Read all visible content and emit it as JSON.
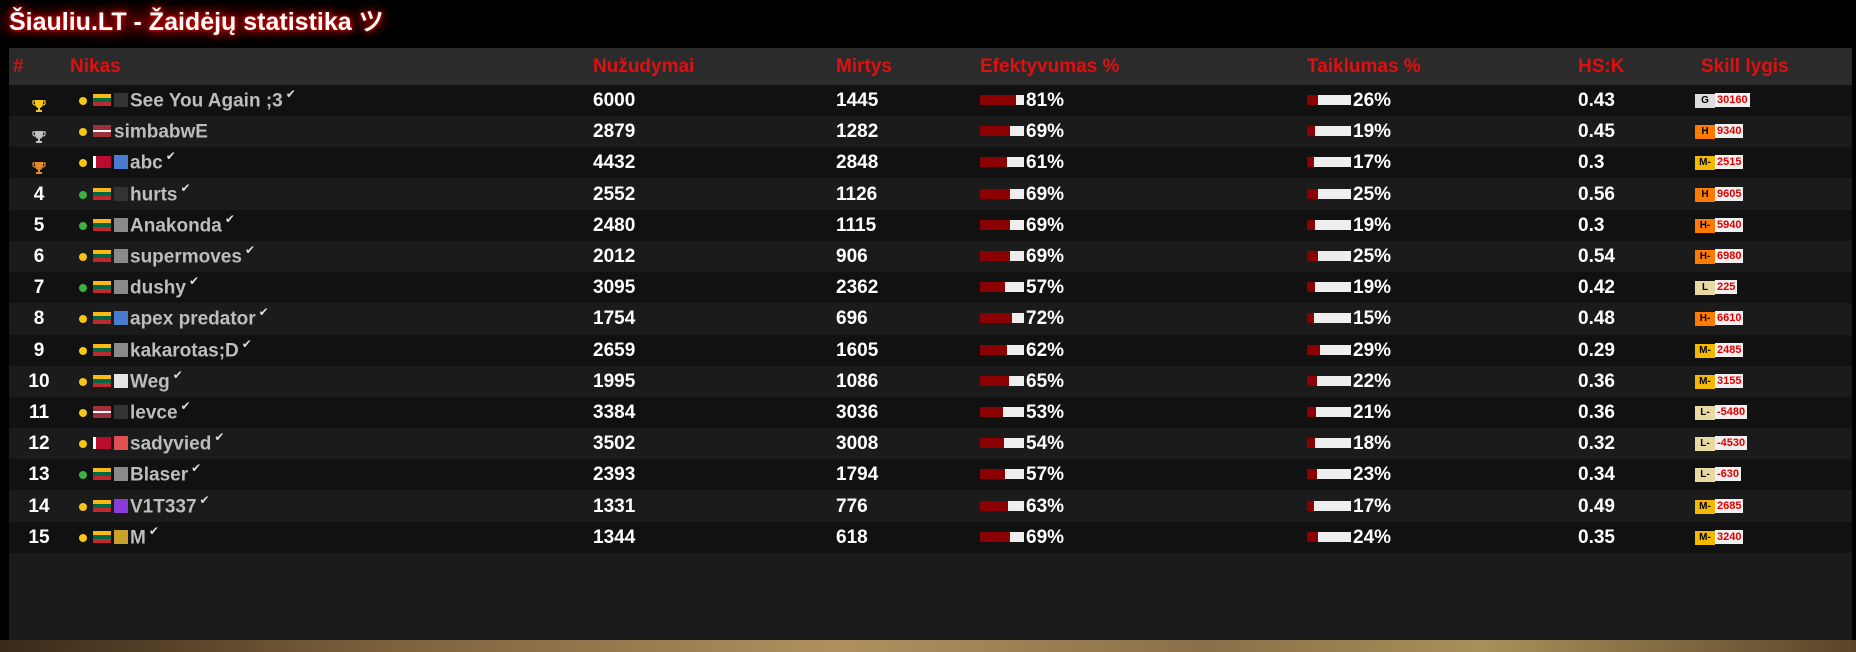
{
  "page": {
    "title": "Šiauliu.LT - Žaidėjų statistika ツ"
  },
  "colors": {
    "accent_red": "#e01010",
    "bar_fill": "#8b0000",
    "gold": "#f5c518",
    "green": "#3cb043"
  },
  "table": {
    "headers": [
      "#",
      "Nikas",
      "Nužudymai",
      "Mirtys",
      "Efektyvumas %",
      "Taiklumas %",
      "HS:K",
      "Skill lygis"
    ],
    "rows": [
      {
        "rank": "",
        "rank_icon": "trophy-gold-icon",
        "status": "gold",
        "flag": "lt",
        "avatar": "dark",
        "name": "See You Again ;3",
        "verified": true,
        "kills": "6000",
        "deaths": "1445",
        "eff": "81%",
        "eff_frac": 0.81,
        "acc": "26%",
        "acc_frac": 0.26,
        "hsk": "0.43",
        "skill_badge": "G",
        "skill_color": "#dddddd",
        "skill_points": "30160"
      },
      {
        "rank": "",
        "rank_icon": "trophy-silver-icon",
        "status": "gold",
        "flag": "lv",
        "avatar": "",
        "name": "simbabwE",
        "verified": false,
        "kills": "2879",
        "deaths": "1282",
        "eff": "69%",
        "eff_frac": 0.69,
        "acc": "19%",
        "acc_frac": 0.19,
        "hsk": "0.45",
        "skill_badge": "H",
        "skill_color": "#ff7a00",
        "skill_points": "9340"
      },
      {
        "rank": "",
        "rank_icon": "trophy-bronze-icon",
        "status": "gold",
        "flag": "no",
        "avatar": "blue",
        "name": "abc",
        "verified": true,
        "kills": "4432",
        "deaths": "2848",
        "eff": "61%",
        "eff_frac": 0.61,
        "acc": "17%",
        "acc_frac": 0.17,
        "hsk": "0.3",
        "skill_badge": "M-",
        "skill_color": "#f5b800",
        "skill_points": "2515"
      },
      {
        "rank": "4",
        "rank_icon": "",
        "status": "green",
        "flag": "lt",
        "avatar": "dark",
        "name": "hurts",
        "verified": true,
        "kills": "2552",
        "deaths": "1126",
        "eff": "69%",
        "eff_frac": 0.69,
        "acc": "25%",
        "acc_frac": 0.25,
        "hsk": "0.56",
        "skill_badge": "H",
        "skill_color": "#ff7a00",
        "skill_points": "9605"
      },
      {
        "rank": "5",
        "rank_icon": "",
        "status": "green",
        "flag": "lt",
        "avatar": "grey",
        "name": "Anakonda",
        "verified": true,
        "kills": "2480",
        "deaths": "1115",
        "eff": "69%",
        "eff_frac": 0.69,
        "acc": "19%",
        "acc_frac": 0.19,
        "hsk": "0.3",
        "skill_badge": "H-",
        "skill_color": "#ff7a00",
        "skill_points": "5940"
      },
      {
        "rank": "6",
        "rank_icon": "",
        "status": "gold",
        "flag": "lt",
        "avatar": "grey",
        "name": "supermoves",
        "verified": true,
        "kills": "2012",
        "deaths": "906",
        "eff": "69%",
        "eff_frac": 0.69,
        "acc": "25%",
        "acc_frac": 0.25,
        "hsk": "0.54",
        "skill_badge": "H-",
        "skill_color": "#ff7a00",
        "skill_points": "6980"
      },
      {
        "rank": "7",
        "rank_icon": "",
        "status": "green",
        "flag": "lt",
        "avatar": "grey",
        "name": "dushy",
        "verified": true,
        "kills": "3095",
        "deaths": "2362",
        "eff": "57%",
        "eff_frac": 0.57,
        "acc": "19%",
        "acc_frac": 0.19,
        "hsk": "0.42",
        "skill_badge": "L",
        "skill_color": "#e8d9a0",
        "skill_points": "225"
      },
      {
        "rank": "8",
        "rank_icon": "",
        "status": "gold",
        "flag": "lt",
        "avatar": "blue",
        "name": "apex predator",
        "verified": true,
        "kills": "1754",
        "deaths": "696",
        "eff": "72%",
        "eff_frac": 0.72,
        "acc": "15%",
        "acc_frac": 0.15,
        "hsk": "0.48",
        "skill_badge": "H-",
        "skill_color": "#ff7a00",
        "skill_points": "6610"
      },
      {
        "rank": "9",
        "rank_icon": "",
        "status": "gold",
        "flag": "lt",
        "avatar": "grey",
        "name": "kakarotas;D",
        "verified": true,
        "kills": "2659",
        "deaths": "1605",
        "eff": "62%",
        "eff_frac": 0.62,
        "acc": "29%",
        "acc_frac": 0.29,
        "hsk": "0.29",
        "skill_badge": "M-",
        "skill_color": "#f5b800",
        "skill_points": "2485"
      },
      {
        "rank": "10",
        "rank_icon": "",
        "status": "gold",
        "flag": "lt",
        "avatar": "white",
        "name": "Weg",
        "verified": true,
        "kills": "1995",
        "deaths": "1086",
        "eff": "65%",
        "eff_frac": 0.65,
        "acc": "22%",
        "acc_frac": 0.22,
        "hsk": "0.36",
        "skill_badge": "M-",
        "skill_color": "#f5b800",
        "skill_points": "3155"
      },
      {
        "rank": "11",
        "rank_icon": "",
        "status": "gold",
        "flag": "lv",
        "avatar": "dark",
        "name": "levce",
        "verified": true,
        "kills": "3384",
        "deaths": "3036",
        "eff": "53%",
        "eff_frac": 0.53,
        "acc": "21%",
        "acc_frac": 0.21,
        "hsk": "0.36",
        "skill_badge": "L-",
        "skill_color": "#e8d9a0",
        "skill_points": "-5480"
      },
      {
        "rank": "12",
        "rank_icon": "",
        "status": "gold",
        "flag": "no",
        "avatar": "red",
        "name": "sadyvied",
        "verified": true,
        "kills": "3502",
        "deaths": "3008",
        "eff": "54%",
        "eff_frac": 0.54,
        "acc": "18%",
        "acc_frac": 0.18,
        "hsk": "0.32",
        "skill_badge": "L-",
        "skill_color": "#e8d9a0",
        "skill_points": "-4530"
      },
      {
        "rank": "13",
        "rank_icon": "",
        "status": "green",
        "flag": "lt",
        "avatar": "grey",
        "name": "Blaser",
        "verified": true,
        "kills": "2393",
        "deaths": "1794",
        "eff": "57%",
        "eff_frac": 0.57,
        "acc": "23%",
        "acc_frac": 0.23,
        "hsk": "0.34",
        "skill_badge": "L-",
        "skill_color": "#e8d9a0",
        "skill_points": "-630"
      },
      {
        "rank": "14",
        "rank_icon": "",
        "status": "gold",
        "flag": "lt",
        "avatar": "purple",
        "name": "V1T337",
        "verified": true,
        "kills": "1331",
        "deaths": "776",
        "eff": "63%",
        "eff_frac": 0.63,
        "acc": "17%",
        "acc_frac": 0.17,
        "hsk": "0.49",
        "skill_badge": "M-",
        "skill_color": "#f5b800",
        "skill_points": "2685"
      },
      {
        "rank": "15",
        "rank_icon": "",
        "status": "gold",
        "flag": "lt",
        "avatar": "gold",
        "name": "M",
        "verified": true,
        "kills": "1344",
        "deaths": "618",
        "eff": "69%",
        "eff_frac": 0.69,
        "acc": "24%",
        "acc_frac": 0.24,
        "hsk": "0.35",
        "skill_badge": "M-",
        "skill_color": "#f5b800",
        "skill_points": "3240"
      }
    ]
  }
}
